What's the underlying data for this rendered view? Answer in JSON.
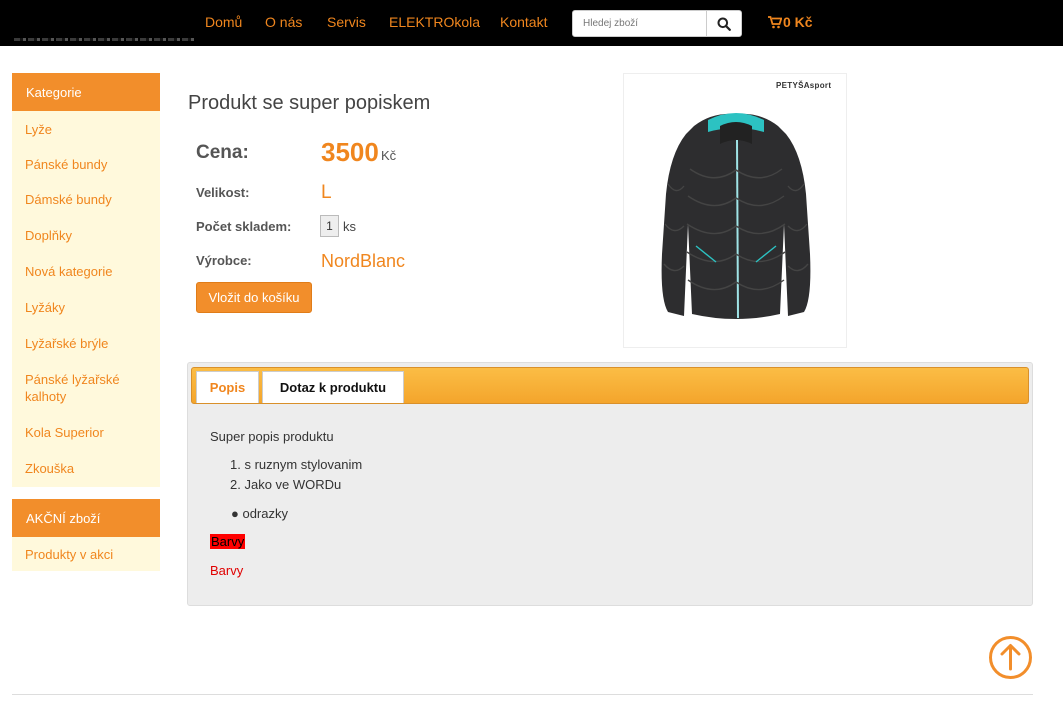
{
  "nav": {
    "items": [
      "Domů",
      "O nás",
      "Servis",
      "ELEKTROkola",
      "Kontakt"
    ],
    "search_placeholder": "Hledej zboží",
    "cart_total": "0 Kč"
  },
  "sidebar": {
    "categories_title": "Kategorie",
    "categories": [
      "Lyže",
      "Pánské bundy",
      "Dámské bundy",
      "Doplňky",
      "Nová kategorie",
      "Lyžáky",
      "Lyžařské brýle",
      "Pánské lyžařské kalhoty",
      "Kola Superior",
      "Zkouška"
    ],
    "promo_title": "AKČNÍ zboží",
    "promo_items": [
      "Produkty v akci"
    ]
  },
  "product": {
    "title": "Produkt se super popiskem",
    "price_label": "Cena:",
    "price_value": "3500",
    "price_currency": "Kč",
    "size_label": "Velikost:",
    "size_value": "L",
    "stock_label": "Počet skladem:",
    "stock_value": "1",
    "stock_unit": "ks",
    "maker_label": "Výrobce:",
    "maker_value": "NordBlanc",
    "add_to_cart": "Vložit do košíku",
    "image_brand": "PETYŠAsport"
  },
  "tabs": {
    "labels": [
      "Popis",
      "Dotaz k produktu"
    ],
    "active": 0
  },
  "description": {
    "intro": "Super popis produktu",
    "ordered": [
      "s ruznym stylovanim",
      "Jako ve WORDu"
    ],
    "bullets": [
      "odrazky"
    ],
    "highlight": "Barvy",
    "red_text": "Barvy"
  },
  "colors": {
    "accent": "#f28e2b",
    "sidebar_bg": "#fff9dc"
  }
}
